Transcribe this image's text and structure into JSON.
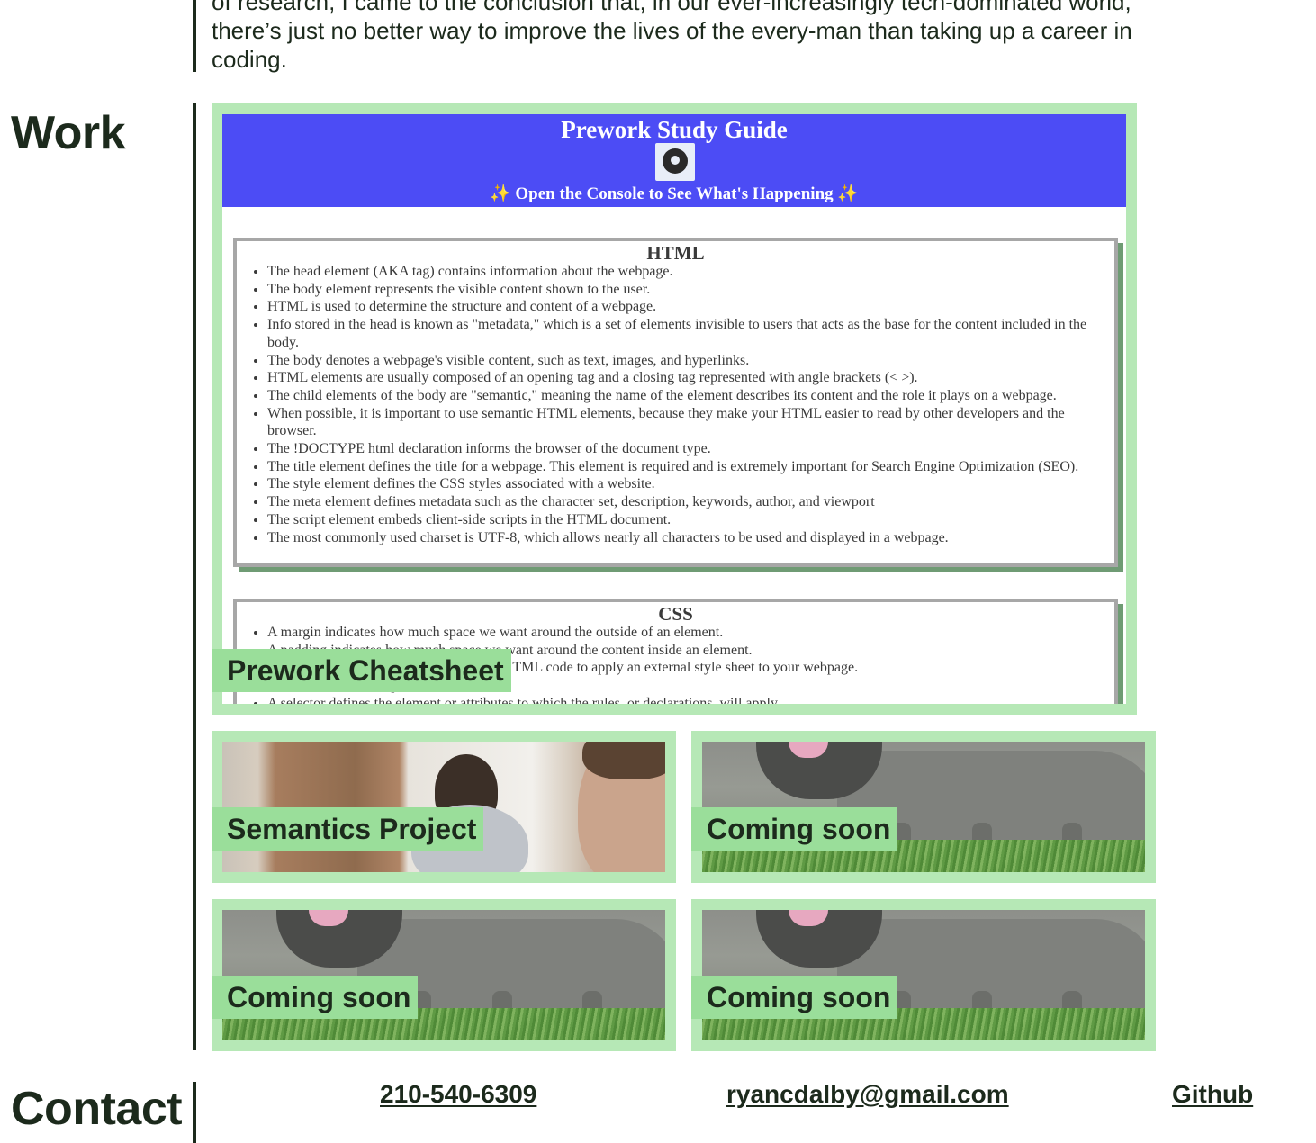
{
  "about": {
    "text": "of research, I came to the conclusion that, in our ever-increasingly tech-dominated world, there’s just no better way to improve the lives of the every-man than taking up a career in coding."
  },
  "work": {
    "heading": "Work",
    "featured": {
      "label": "Prework Cheatsheet",
      "screenshot": {
        "title": "Prework Study Guide",
        "subtitle": "✨ Open the Console to See What's Happening ✨",
        "html_section": {
          "heading": "HTML",
          "items": [
            "The head element (AKA tag) contains information about the webpage.",
            "The body element represents the visible content shown to the user.",
            "HTML is used to determine the structure and content of a webpage.",
            "Info stored in the head is known as \"metadata,\" which is a set of elements invisible to users that acts as the base for the content included in the body.",
            "The body denotes a webpage's visible content, such as text, images, and hyperlinks.",
            "HTML elements are usually composed of an opening tag and a closing tag represented with angle brackets (< >).",
            "The child elements of the body are \"semantic,\" meaning the name of the element describes its content and the role it plays on a webpage.",
            "When possible, it is important to use semantic HTML elements, because they make your HTML easier to read by other developers and the browser.",
            "The !DOCTYPE html declaration informs the browser of the document type.",
            "The title element defines the title for a webpage. This element is required and is extremely important for Search Engine Optimization (SEO).",
            "The style element defines the CSS styles associated with a website.",
            "The meta element defines metadata such as the character set, description, keywords, author, and viewport",
            "The script element embeds client-side scripts in the HTML document.",
            "The most commonly used charset is UTF-8, which allows nearly all characters to be used and displayed in a webpage."
          ]
        },
        "css_section": {
          "heading": "CSS",
          "items": [
            "A margin indicates how much space we want around the outside of an element.",
            "A padding indicates how much space we want around the content inside an element.",
            "Use a link element in the header of your HTML code to apply an external style sheet to your webpage.",
            "A CSS rule is made up of declarations.",
            "A selector defines the element or attributes to which the rules, or declarations, will apply."
          ]
        }
      }
    },
    "projects": [
      {
        "label": "Semantics Project"
      },
      {
        "label": "Coming soon"
      },
      {
        "label": "Coming soon"
      },
      {
        "label": "Coming soon"
      }
    ]
  },
  "contact": {
    "heading": "Contact",
    "phone": "210-540-6309",
    "email": "ryancdalby@gmail.com",
    "github": "Github"
  },
  "colors": {
    "text": "#1c2a1c",
    "card_border": "#b6e8b6",
    "card_label_bg": "#9ade9a",
    "screenshot_header": "#4c4cf5"
  }
}
